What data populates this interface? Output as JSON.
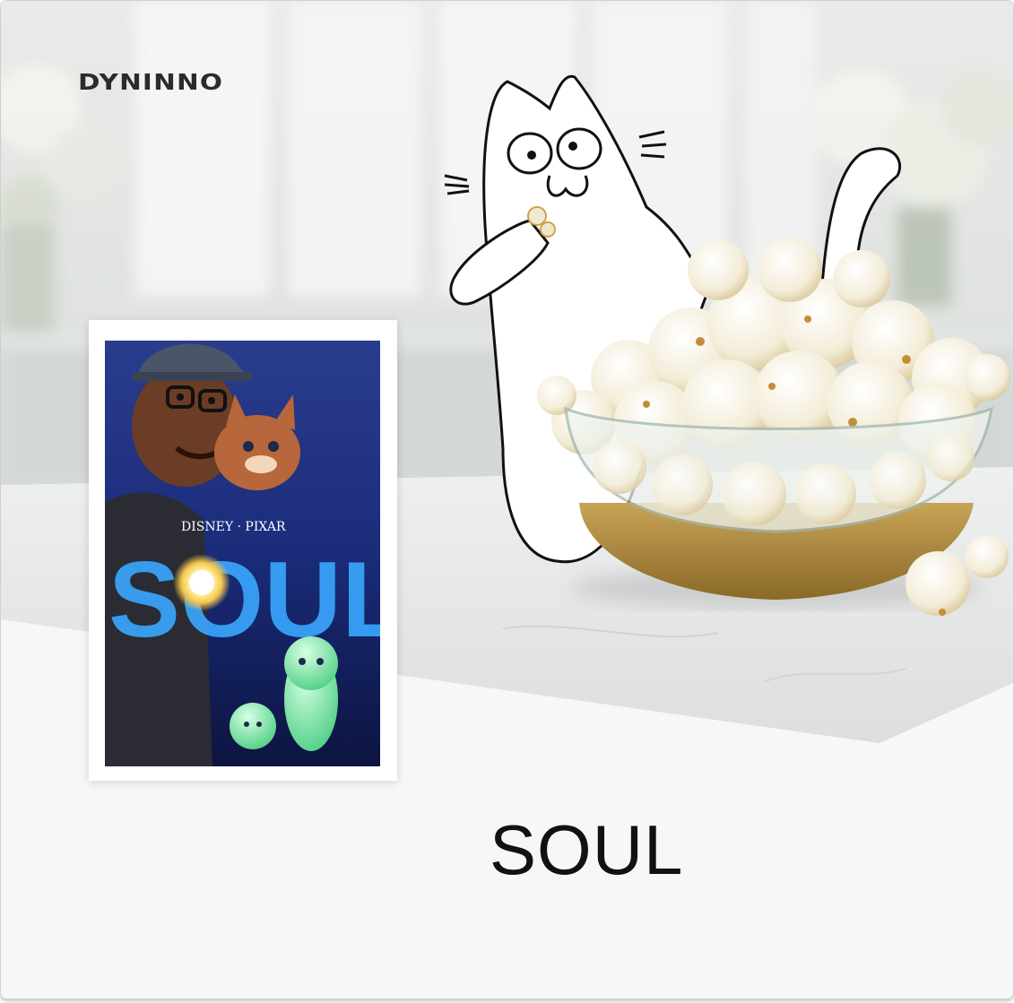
{
  "brand": {
    "logo_text": "DYNINNO"
  },
  "poster": {
    "studio_label": "DISNEY · PIXAR",
    "title_art": "SOUL"
  },
  "caption": {
    "title": "SOUL"
  },
  "colors": {
    "page_background": "#f7f7f7",
    "title_text": "#111111",
    "poster_sky": "#1a2c7a",
    "poster_glow": "#f4c64a",
    "bowl_gold": "#b08b3c"
  },
  "icons": [
    "cat-illustration",
    "popcorn-bowl-photo",
    "movie-poster"
  ]
}
